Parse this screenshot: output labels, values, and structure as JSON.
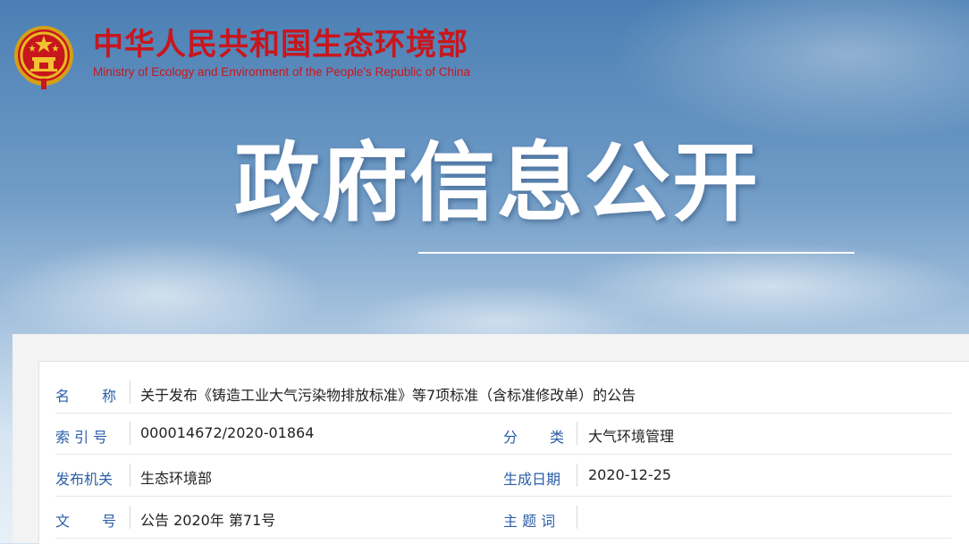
{
  "header": {
    "site_name_cn": "中华人民共和国生态环境部",
    "site_name_en": "Ministry of Ecology and Environment of the People's Republic of China",
    "emblem_icon": "national-emblem-icon",
    "brand_color": "#c8161d"
  },
  "hero": {
    "title": "政府信息公开"
  },
  "info": {
    "name_label": "名　称",
    "name_value": "关于发布《铸造工业大气污染物排放标准》等7项标准（含标准修改单）的公告",
    "index_label": "索 引 号",
    "index_value": "000014672/2020-01864",
    "category_label": "分　类",
    "category_value": "大气环境管理",
    "publisher_label": "发布机关",
    "publisher_value": "生态环境部",
    "date_label": "生成日期",
    "date_value": "2020-12-25",
    "doc_no_label": "文　号",
    "doc_no_value": "公告 2020年 第71号",
    "keywords_label": "主 题 词",
    "keywords_value": "",
    "label_color": "#2a5ea8"
  }
}
